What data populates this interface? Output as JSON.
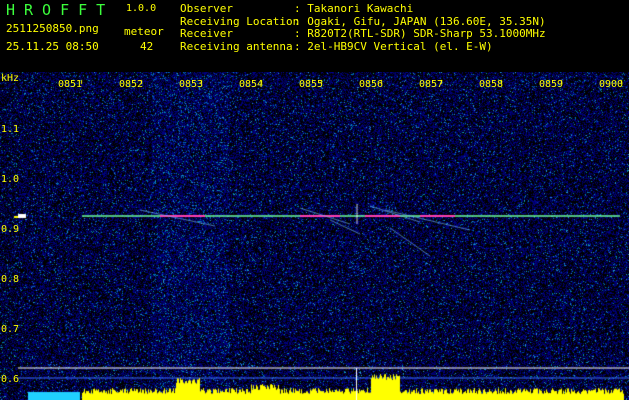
{
  "header": {
    "title": "HROFFT",
    "version": "1.0.0",
    "filename": "2511250850.png",
    "datetime": "25.11.25 08:50",
    "meteor_label": "meteor",
    "meteor_count": "42"
  },
  "info": {
    "observer_key": "Observer",
    "observer_val": ": Takanori Kawachi",
    "location_key": "Receiving Location",
    "location_val": ": Ogaki, Gifu, JAPAN (136.60E, 35.35N)",
    "receiver_key": "Receiver",
    "receiver_val": ": R820T2(RTL-SDR) SDR-Sharp 53.1000MHz",
    "antenna_key": "Receiving antenna",
    "antenna_val": ": 2el-HB9CV Vertical (el. E-W)"
  },
  "axis": {
    "unit": "kHz",
    "y_ticks": [
      "1.1",
      "1.0",
      "0.9",
      "0.8",
      "0.7",
      "0.6"
    ],
    "x_ticks": [
      "0851",
      "0852",
      "0853",
      "0854",
      "0855",
      "0856",
      "0857",
      "0858",
      "0859",
      "0900"
    ]
  },
  "colors": {
    "label": "#ffff00",
    "title": "#3cff3c",
    "noise": "#14148c",
    "echo_line": "#6cff9c",
    "echo_hot": "#ff40b0"
  }
}
